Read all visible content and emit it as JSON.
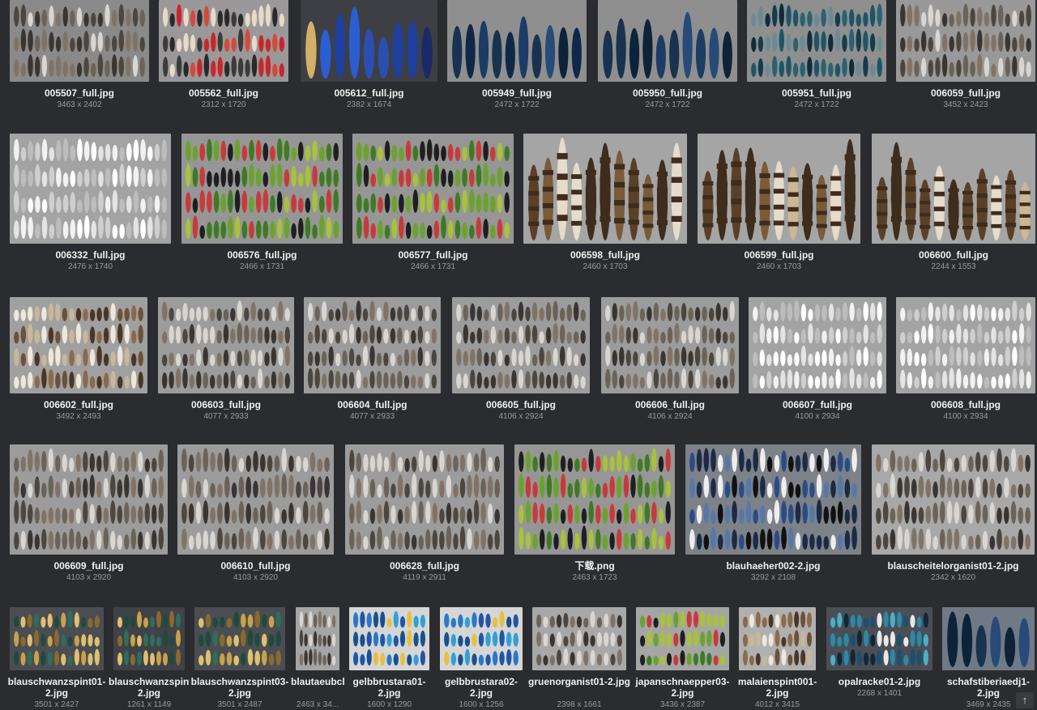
{
  "gallery": {
    "items": [
      {
        "file": "005507_full.jpg",
        "size": "3463 x 2402",
        "bg": "#8a8a8a",
        "style": "grey"
      },
      {
        "file": "005562_full.jpg",
        "size": "2312 x 1720",
        "bg": "#9a9898",
        "style": "red"
      },
      {
        "file": "005612_full.jpg",
        "size": "2382 x 1674",
        "bg": "#3d3f44",
        "style": "bluewing"
      },
      {
        "file": "005949_full.jpg",
        "size": "2472 x 1722",
        "bg": "#8f8f8f",
        "style": "darkblue"
      },
      {
        "file": "005950_full.jpg",
        "size": "2472 x 1722",
        "bg": "#8f8f8f",
        "style": "darkblue"
      },
      {
        "file": "005951_full.jpg",
        "size": "2472 x 1722",
        "bg": "#8f8f8f",
        "style": "teal"
      },
      {
        "file": "006059_full.jpg",
        "size": "3452 x 2423",
        "bg": "#999999",
        "style": "grey"
      },
      {
        "file": "006332_full.jpg",
        "size": "2476 x 1740",
        "bg": "#a3a3a3",
        "style": "white"
      },
      {
        "file": "006576_full.jpg",
        "size": "2466 x 1731",
        "bg": "#969696",
        "style": "green"
      },
      {
        "file": "006577_full.jpg",
        "size": "2466 x 1731",
        "bg": "#969696",
        "style": "green"
      },
      {
        "file": "006598_full.jpg",
        "size": "2460 x 1703",
        "bg": "#a5a5a5",
        "style": "barred"
      },
      {
        "file": "006599_full.jpg",
        "size": "2460 x 1703",
        "bg": "#a5a5a5",
        "style": "barred"
      },
      {
        "file": "006600_full.jpg",
        "size": "2244 x 1553",
        "bg": "#a5a5a5",
        "style": "barred"
      },
      {
        "file": "006602_full.jpg",
        "size": "3492 x 2493",
        "bg": "#a0a0a0",
        "style": "brown"
      },
      {
        "file": "006603_full.jpg",
        "size": "4077 x 2933",
        "bg": "#9c9c9c",
        "style": "grey"
      },
      {
        "file": "006604_full.jpg",
        "size": "4077 x 2933",
        "bg": "#9c9c9c",
        "style": "grey"
      },
      {
        "file": "006605_full.jpg",
        "size": "4106 x 2924",
        "bg": "#9c9c9c",
        "style": "grey"
      },
      {
        "file": "006606_full.jpg",
        "size": "4106 x 2924",
        "bg": "#9c9c9c",
        "style": "grey"
      },
      {
        "file": "006607_full.jpg",
        "size": "4100 x 2934",
        "bg": "#a3a3a3",
        "style": "white"
      },
      {
        "file": "006608_full.jpg",
        "size": "4100 x 2934",
        "bg": "#a3a3a3",
        "style": "white"
      },
      {
        "file": "006609_full.jpg",
        "size": "4103 x 2920",
        "bg": "#9c9c9c",
        "style": "grey"
      },
      {
        "file": "006610_full.jpg",
        "size": "4103 x 2920",
        "bg": "#9c9c9c",
        "style": "grey"
      },
      {
        "file": "006628_full.jpg",
        "size": "4119 x 2911",
        "bg": "#9c9c9c",
        "style": "grey"
      },
      {
        "file": "下载.png",
        "size": "2463 x 1723",
        "bg": "#969696",
        "style": "green"
      },
      {
        "file": "blauhaeher002-2.jpg",
        "size": "3292 x 2108",
        "bg": "#7d8288",
        "style": "jay"
      },
      {
        "file": "blauscheitelorganist01-2.jpg",
        "size": "2342 x 1620",
        "bg": "#a8a8a8",
        "style": "grey"
      },
      {
        "file": "blauschwanzspint01-2.jpg",
        "size": "3501 x 2427",
        "bg": "#4a4d52",
        "style": "golden"
      },
      {
        "file": "blauschwanzspint02-2.jpg",
        "size": "1261 x 1149",
        "bg": "#3f4247",
        "style": "golden"
      },
      {
        "file": "blauschwanzspint03-2.jpg",
        "size": "3501 x 2487",
        "bg": "#4a4d52",
        "style": "golden"
      },
      {
        "file": "blautaeubchen01-...",
        "size": "2463 x 34...",
        "bg": "#a5a5a5",
        "style": "grey"
      },
      {
        "file": "gelbbrustara01-2.jpg",
        "size": "1600 x 1290",
        "bg": "#d6d6d6",
        "style": "macaw"
      },
      {
        "file": "gelbbrustara02-2.jpg",
        "size": "1600 x 1256",
        "bg": "#d6d6d6",
        "style": "macaw"
      },
      {
        "file": "gruenorganist01-2.jpg",
        "size": "2398 x 1661",
        "bg": "#a8a8a8",
        "style": "grey"
      },
      {
        "file": "japanschnaepper03-2.jpg",
        "size": "3436 x 2387",
        "bg": "#a5a5a5",
        "style": "green"
      },
      {
        "file": "malaienspint001-2.jpg",
        "size": "4012 x 3415",
        "bg": "#b0b0b0",
        "style": "brown"
      },
      {
        "file": "opalracke01-2.jpg",
        "size": "2268 x 1401",
        "bg": "#4a4e55",
        "style": "opal"
      },
      {
        "file": "schafstiberiaedj1-2.jpg",
        "size": "3469 x 2435",
        "bg": "#6f7a86",
        "style": "darkblue"
      }
    ]
  }
}
